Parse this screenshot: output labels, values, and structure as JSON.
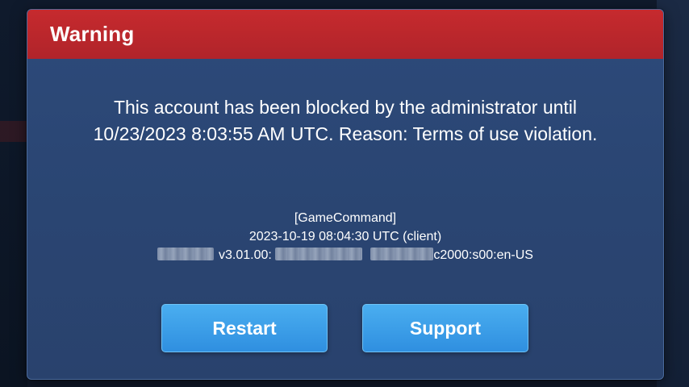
{
  "dialog": {
    "title": "Warning",
    "message_line1": "This account has been blocked by the administrator until",
    "message_line2": "10/23/2023 8:03:55 AM UTC. Reason: Terms of use violation.",
    "meta": {
      "source": "[GameCommand]",
      "timestamp": "2023-10-19 08:04:30 UTC (client)",
      "version_prefix": "v3.01.00:",
      "version_suffix": "c2000:s00:en-US"
    },
    "buttons": {
      "restart": "Restart",
      "support": "Support"
    }
  },
  "colors": {
    "header_red": "#c62a2e",
    "dialog_blue": "#2d4a7a",
    "button_blue": "#3a9ee8"
  }
}
